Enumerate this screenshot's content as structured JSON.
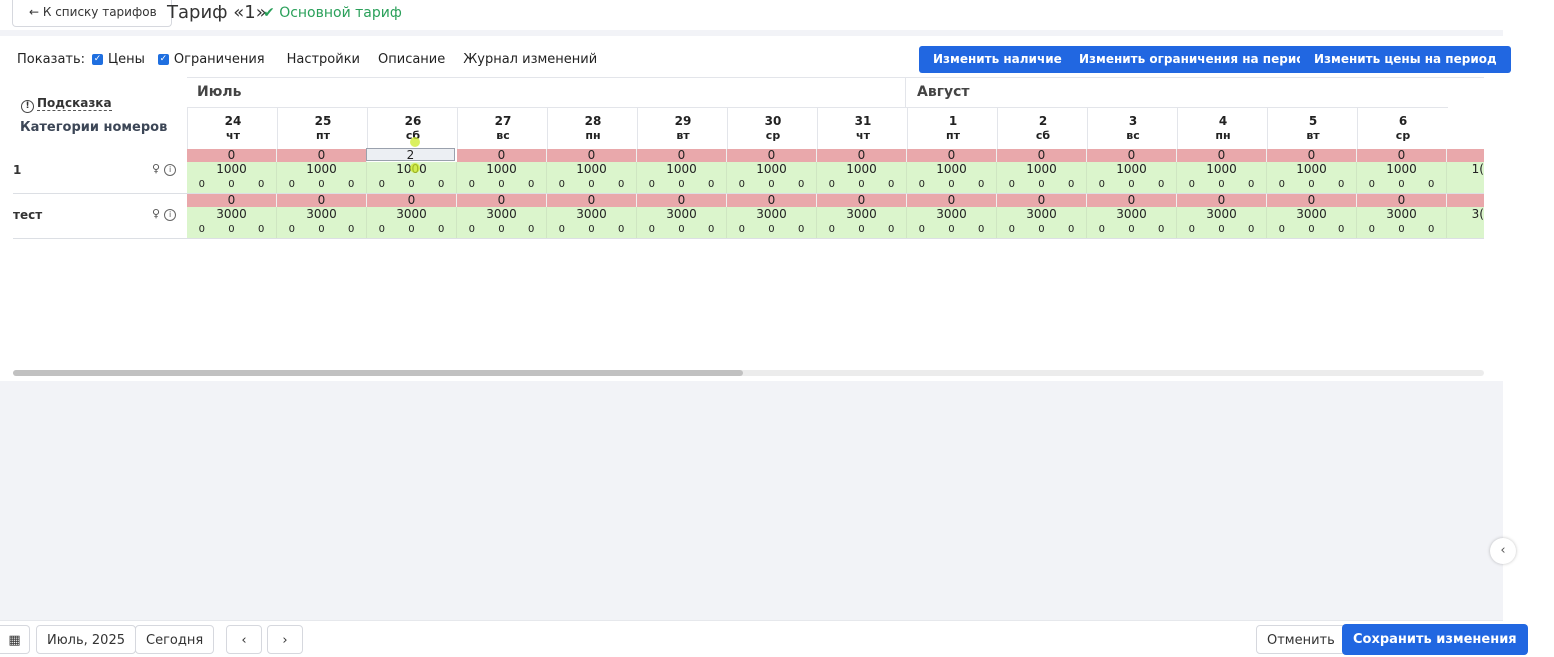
{
  "header": {
    "back_label": "← К списку тарифов",
    "title": "Тариф «1»",
    "badge": "Основной тариф",
    "badge_color": "#2aa05a"
  },
  "toolbar": {
    "show_label": "Показать:",
    "prices_label": "Цены",
    "prices_checked": true,
    "limits_label": "Ограничения",
    "limits_checked": true,
    "settings_link": "Настройки",
    "description_link": "Описание",
    "log_link": "Журнал изменений"
  },
  "actions": {
    "availability": "Изменить наличие",
    "limits_period": "Изменить ограничения на период",
    "prices_period": "Изменить цены на период",
    "accent_color": "#2167e1"
  },
  "grid": {
    "hint": "Подсказка",
    "categories_header": "Категории номеров",
    "months": [
      "Июль",
      "Август"
    ],
    "days": [
      {
        "n": "24",
        "w": "чт"
      },
      {
        "n": "25",
        "w": "пт"
      },
      {
        "n": "26",
        "w": "сб"
      },
      {
        "n": "27",
        "w": "вс"
      },
      {
        "n": "28",
        "w": "пн"
      },
      {
        "n": "29",
        "w": "вт"
      },
      {
        "n": "30",
        "w": "ср"
      },
      {
        "n": "31",
        "w": "чт"
      },
      {
        "n": "1",
        "w": "пт"
      },
      {
        "n": "2",
        "w": "сб"
      },
      {
        "n": "3",
        "w": "вс"
      },
      {
        "n": "4",
        "w": "пн"
      },
      {
        "n": "5",
        "w": "вт"
      },
      {
        "n": "6",
        "w": "ср"
      }
    ],
    "editing_value": "2",
    "rows": [
      {
        "name": "1",
        "availability": "0",
        "price": "1000",
        "sub": [
          "0",
          "0",
          "0"
        ],
        "partial_price": "1("
      },
      {
        "name": "тест",
        "availability": "0",
        "price": "3000",
        "sub": [
          "0",
          "0",
          "0"
        ],
        "partial_price": "3("
      }
    ]
  },
  "footer": {
    "period": "Июль, 2025",
    "today": "Сегодня",
    "cancel": "Отменить",
    "save": "Сохранить изменения"
  }
}
